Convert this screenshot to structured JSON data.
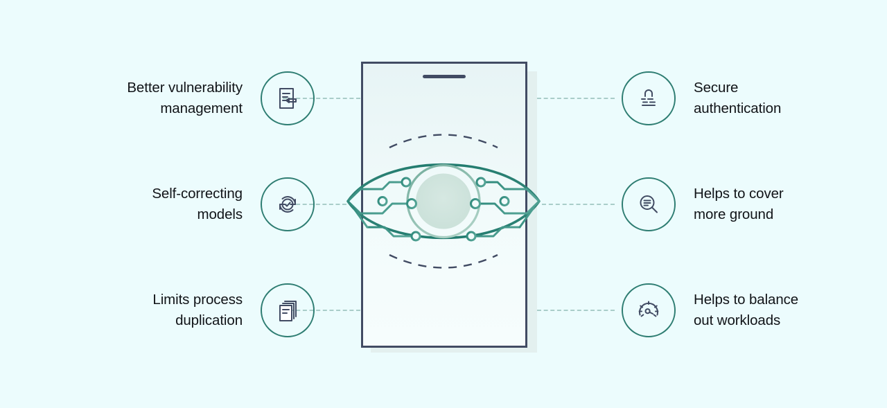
{
  "theme": {
    "background": "#ecfcfd",
    "accent_teal": "#2e7d72",
    "accent_teal_light": "#53a395",
    "navy": "#414b63",
    "dashed_connector": "#a9cdc9",
    "text": "#111418",
    "phone_screen_top": "#e7f4f5",
    "phone_screen_bottom": "#f6fdfd",
    "pupil_fill": "#cfe3dd",
    "phone_shadow": "#e3f0ef"
  },
  "center": {
    "device": "smartphone-frame",
    "illustration": "circuit-board-eye",
    "speaker_bar": true,
    "dashed_arcs": 2
  },
  "features": {
    "left": [
      {
        "id": "better-vulnerability-management",
        "label": "Better vulnerability\nmanagement",
        "icon": "document-edit-icon"
      },
      {
        "id": "self-correcting-models",
        "label": "Self-correcting\nmodels",
        "icon": "refresh-check-icon"
      },
      {
        "id": "limits-process-duplication",
        "label": "Limits process\nduplication",
        "icon": "copy-documents-icon"
      }
    ],
    "right": [
      {
        "id": "secure-authentication",
        "label": "Secure\nauthentication",
        "icon": "padlock-icon"
      },
      {
        "id": "helps-to-cover-more-ground",
        "label": "Helps to cover\nmore ground",
        "icon": "magnifier-lines-icon"
      },
      {
        "id": "helps-to-balance-out-workloads",
        "label": "Helps to balance\nout workloads",
        "icon": "speedometer-icon"
      }
    ]
  }
}
